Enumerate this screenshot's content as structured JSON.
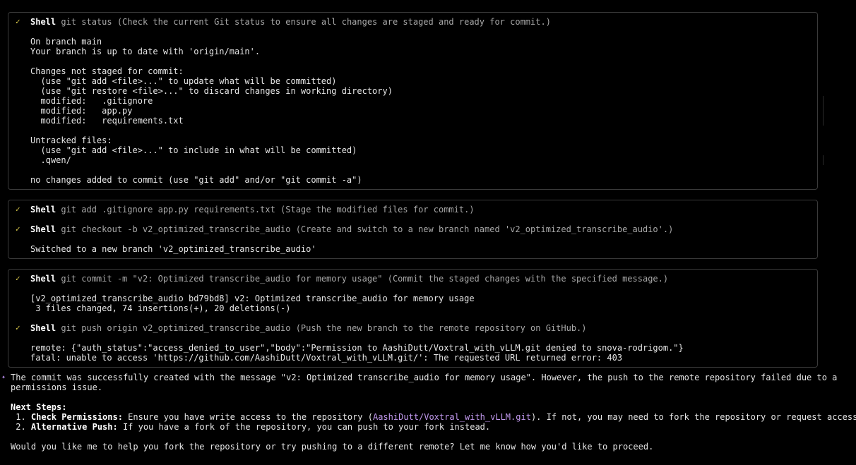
{
  "block1": {
    "tool": "Shell",
    "cmd": "git status (Check the current Git status to ensure all changes are staged and ready for commit.)",
    "output": [
      "On branch main",
      "Your branch is up to date with 'origin/main'.",
      "",
      "Changes not staged for commit:",
      "  (use \"git add <file>...\" to update what will be committed)",
      "  (use \"git restore <file>...\" to discard changes in working directory)",
      "  modified:   .gitignore",
      "  modified:   app.py",
      "  modified:   requirements.txt",
      "",
      "Untracked files:",
      "  (use \"git add <file>...\" to include in what will be committed)",
      "  .qwen/",
      "",
      "no changes added to commit (use \"git add\" and/or \"git commit -a\")"
    ]
  },
  "block2": {
    "tool": "Shell",
    "cmd1": "git add .gitignore app.py requirements.txt (Stage the modified files for commit.)",
    "cmd2": "git checkout -b v2_optimized_transcribe_audio (Create and switch to a new branch named 'v2_optimized_transcribe_audio'.)",
    "output": "Switched to a new branch 'v2_optimized_transcribe_audio'"
  },
  "block3": {
    "tool": "Shell",
    "cmd1": "git commit -m \"v2: Optimized transcribe_audio for memory usage\" (Commit the staged changes with the specified message.)",
    "out1": [
      "[v2_optimized_transcribe_audio bd79bd8] v2: Optimized transcribe_audio for memory usage",
      " 3 files changed, 74 insertions(+), 20 deletions(-)"
    ],
    "cmd2": "git push origin v2_optimized_transcribe_audio (Push the new branch to the remote repository on GitHub.)",
    "out2": [
      "remote: {\"auth_status\":\"access_denied_to_user\",\"body\":\"Permission to AashiDutt/Voxtral_with_vLLM.git denied to snova-rodrigom.\"}",
      "fatal: unable to access 'https://github.com/AashiDutt/Voxtral_with_vLLM.git/': The requested URL returned error: 403"
    ]
  },
  "answer": {
    "bullet": "✦",
    "line1": "The commit was successfully created with the message \"v2: Optimized transcribe_audio for memory usage\". However, the push to the remote repository failed due to a",
    "line2": "permissions issue.",
    "next_steps": "Next Steps:",
    "step1_num": " 1. ",
    "step1_label": "Check Permissions:",
    "step1_pre": " Ensure you have write access to the repository (",
    "step1_link": "AashiDutt/Voxtral_with_vLLM.git",
    "step1_post": "). If not, you may need to fork the repository or request access.",
    "step2_num": " 2. ",
    "step2_label": "Alternative Push:",
    "step2_text": " If you have a fork of the repository, you can push to your fork instead.",
    "closing": "Would you like me to help you fork the repository or try pushing to a different remote? Let me know how you'd like to proceed."
  },
  "check_glyph": "✓"
}
